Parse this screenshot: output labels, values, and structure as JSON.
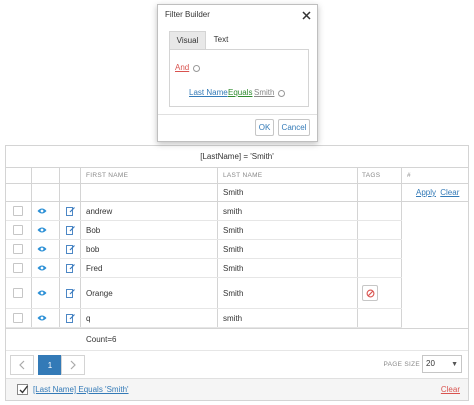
{
  "dialog": {
    "title": "Filter Builder",
    "tabs": [
      {
        "label": "Visual",
        "active": true
      },
      {
        "label": "Text",
        "active": false
      }
    ],
    "group_operator": "And",
    "condition": {
      "field": "Last Name",
      "operation": "Equals",
      "value": "Smith"
    },
    "ok_label": "OK",
    "cancel_label": "Cancel"
  },
  "grid": {
    "filter_expression": "[LastName] = 'Smith'",
    "columns": {
      "first_name": "FIRST NAME",
      "last_name": "LAST NAME",
      "tags": "TAGS",
      "hash": "#"
    },
    "filter_row": {
      "last_name_value": "Smith",
      "apply_label": "Apply",
      "clear_label": "Clear"
    },
    "rows": [
      {
        "first_name": "andrew",
        "last_name": "smith",
        "has_tag_button": false
      },
      {
        "first_name": "Bob",
        "last_name": "Smith",
        "has_tag_button": false
      },
      {
        "first_name": "bob",
        "last_name": "Smith",
        "has_tag_button": false
      },
      {
        "first_name": "Fred",
        "last_name": "Smith",
        "has_tag_button": false
      },
      {
        "first_name": "Orange",
        "last_name": "Smith",
        "has_tag_button": true
      },
      {
        "first_name": "q",
        "last_name": "smith",
        "has_tag_button": false
      }
    ],
    "count_text": "Count=6",
    "pager": {
      "prev_icon": "chevron-left-icon",
      "current_page": "1",
      "next_icon": "chevron-right-icon",
      "page_size_label": "PAGE SIZE",
      "page_size_value": "20"
    },
    "footer_filter": {
      "checked": true,
      "text": "[Last Name] Equals 'Smith'",
      "clear_label": "Clear"
    }
  },
  "colors": {
    "link": "#337ab7",
    "danger": "#d9534f",
    "operation": "#2e8b2e",
    "eye_icon": "#2a8fd6",
    "edit_icon": "#3a7bbf"
  }
}
